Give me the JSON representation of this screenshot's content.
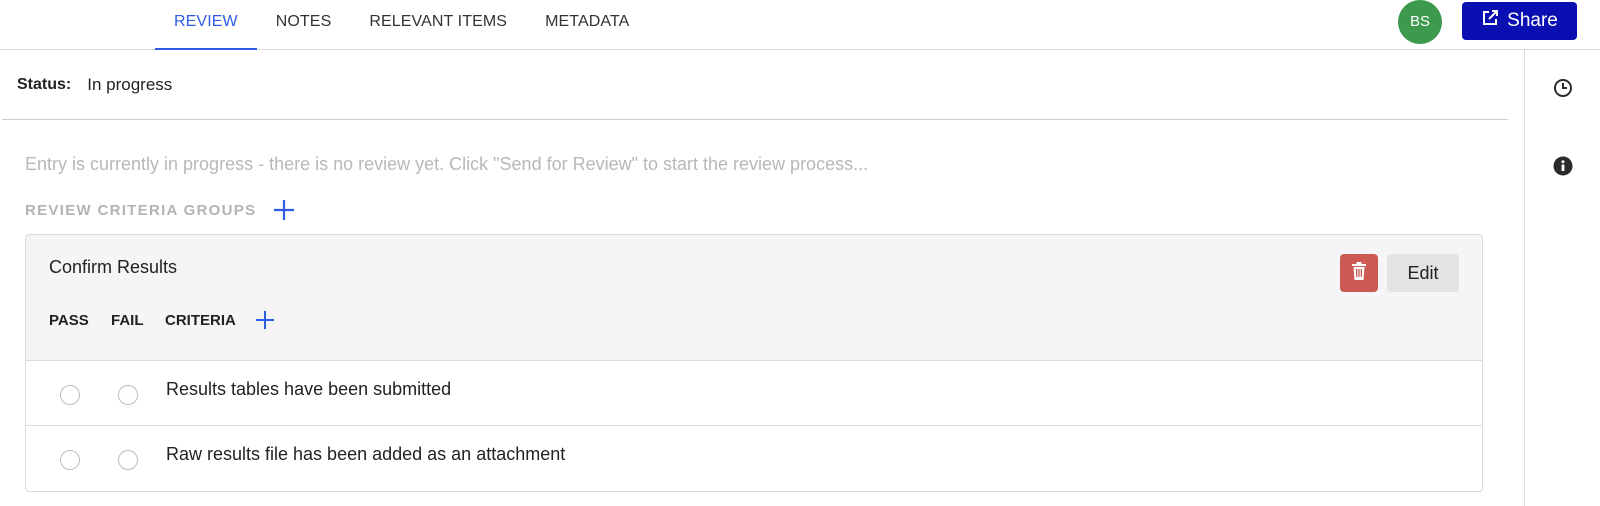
{
  "tabs": [
    {
      "label": "REVIEW",
      "active": true
    },
    {
      "label": "NOTES",
      "active": false
    },
    {
      "label": "RELEVANT ITEMS",
      "active": false
    },
    {
      "label": "METADATA",
      "active": false
    }
  ],
  "user": {
    "initials": "BS",
    "avatar_color": "#3d9a4d"
  },
  "share": {
    "label": "Share",
    "icon": "external-link-icon",
    "color": "#0a0fb2"
  },
  "sidebar": {
    "icons": [
      "clock-icon",
      "info-icon"
    ]
  },
  "status": {
    "label": "Status:",
    "value": "In progress"
  },
  "hint": "Entry is currently in progress - there is no review yet. Click \"Send for Review\" to start the review process...",
  "review_groups": {
    "title": "REVIEW CRITERIA GROUPS",
    "groups": [
      {
        "title": "Confirm Results",
        "edit_label": "Edit",
        "delete_color": "#cc5a52",
        "columns": {
          "pass": "PASS",
          "fail": "FAIL",
          "criteria": "CRITERIA"
        },
        "criteria": [
          {
            "text": "Results tables have been submitted",
            "pass": false,
            "fail": false
          },
          {
            "text": "Raw results file has been added as an attachment",
            "pass": false,
            "fail": false
          }
        ]
      }
    ]
  },
  "accent_color": "#2f5be6"
}
